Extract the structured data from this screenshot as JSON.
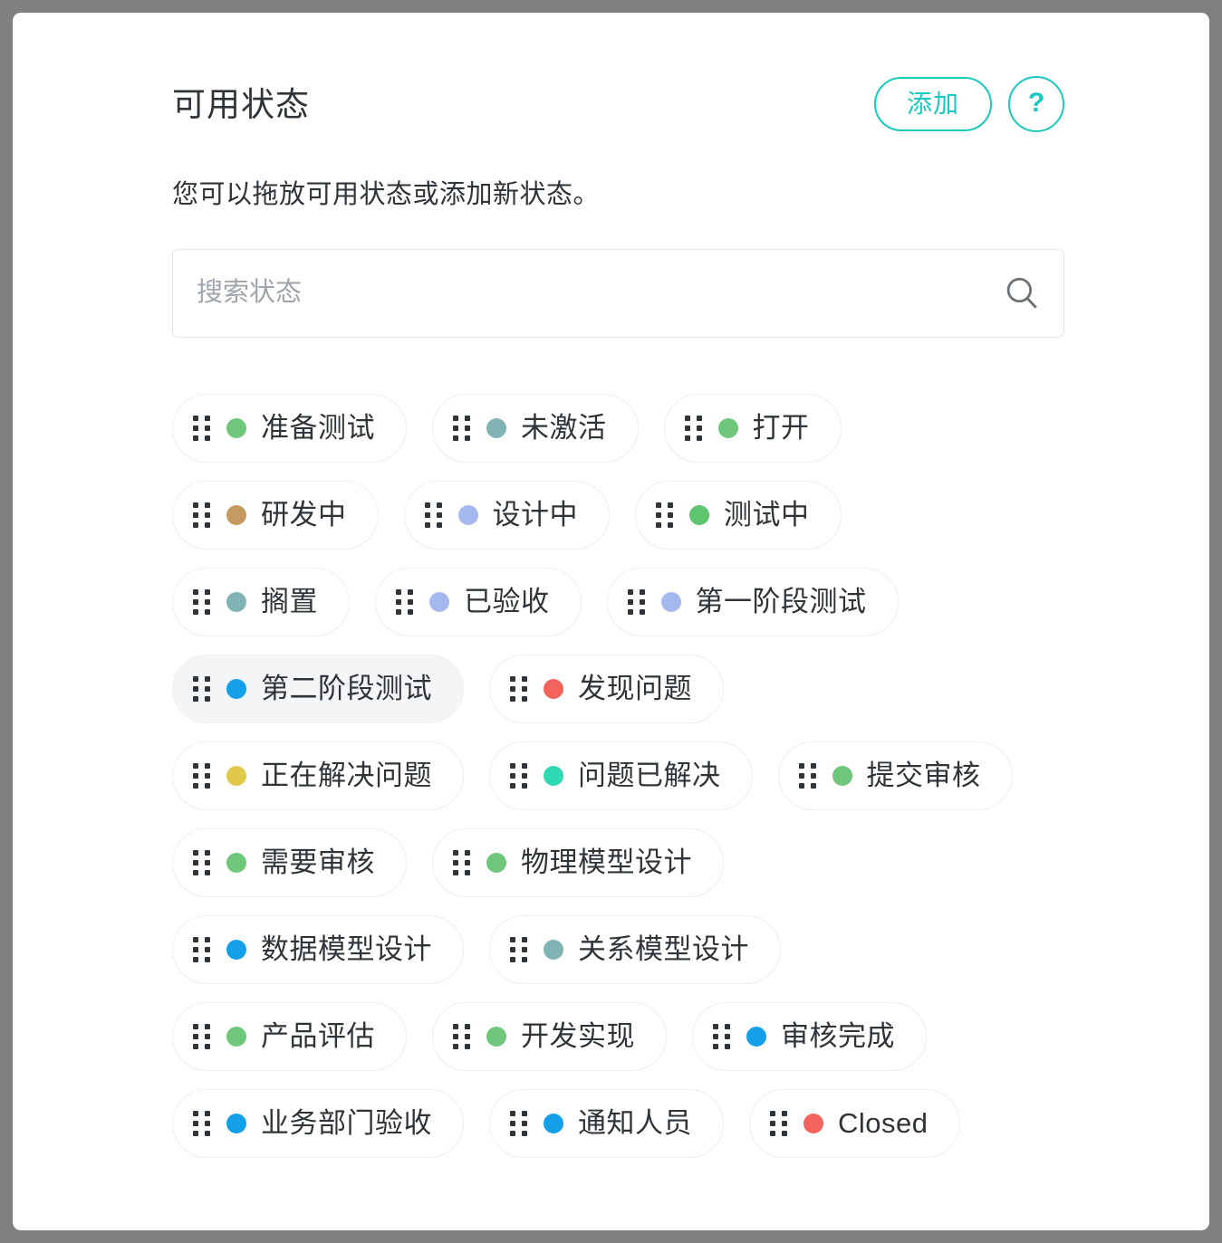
{
  "header": {
    "title": "可用状态",
    "add_label": "添加",
    "help_label": "?",
    "accent_color": "#19c9bf"
  },
  "subtitle": "您可以拖放可用状态或添加新状态。",
  "search": {
    "placeholder": "搜索状态",
    "value": "",
    "icon": "search-icon"
  },
  "status_rows": [
    [
      {
        "label": "准备测试",
        "color": "#6ec77a",
        "highlight": false,
        "handle": "drag-handle-icon"
      },
      {
        "label": "未激活",
        "color": "#80b4b4",
        "highlight": false,
        "handle": "drag-handle-icon"
      },
      {
        "label": "打开",
        "color": "#6ec77a",
        "highlight": false,
        "handle": "drag-handle-icon"
      }
    ],
    [
      {
        "label": "研发中",
        "color": "#c49a60",
        "highlight": false,
        "handle": "drag-handle-icon"
      },
      {
        "label": "设计中",
        "color": "#a5b8ec",
        "highlight": false,
        "handle": "drag-handle-icon"
      },
      {
        "label": "测试中",
        "color": "#5ec46e",
        "highlight": false,
        "handle": "drag-handle-icon"
      }
    ],
    [
      {
        "label": "搁置",
        "color": "#80b4b4",
        "highlight": false,
        "handle": "drag-handle-icon"
      },
      {
        "label": "已验收",
        "color": "#a5b8ec",
        "highlight": false,
        "handle": "drag-handle-icon"
      },
      {
        "label": "第一阶段测试",
        "color": "#a5b8ec",
        "highlight": false,
        "handle": "drag-handle-icon"
      }
    ],
    [
      {
        "label": "第二阶段测试",
        "color": "#13a0e8",
        "highlight": true,
        "handle": "drag-handle-icon"
      },
      {
        "label": "发现问题",
        "color": "#f4635c",
        "highlight": false,
        "handle": "drag-handle-icon"
      }
    ],
    [
      {
        "label": "正在解决问题",
        "color": "#e0c84a",
        "highlight": false,
        "handle": "drag-handle-icon"
      },
      {
        "label": "问题已解决",
        "color": "#2fd9b4",
        "highlight": false,
        "handle": "drag-handle-icon"
      },
      {
        "label": "提交审核",
        "color": "#6ec77a",
        "highlight": false,
        "handle": "drag-handle-icon"
      }
    ],
    [
      {
        "label": "需要审核",
        "color": "#6ec77a",
        "highlight": false,
        "handle": "drag-handle-icon"
      },
      {
        "label": "物理模型设计",
        "color": "#6ec77a",
        "highlight": false,
        "handle": "drag-handle-icon"
      }
    ],
    [
      {
        "label": "数据模型设计",
        "color": "#13a0e8",
        "highlight": false,
        "handle": "drag-handle-icon"
      },
      {
        "label": "关系模型设计",
        "color": "#80b4b4",
        "highlight": false,
        "handle": "drag-handle-icon"
      }
    ],
    [
      {
        "label": "产品评估",
        "color": "#6ec77a",
        "highlight": false,
        "handle": "drag-handle-icon"
      },
      {
        "label": "开发实现",
        "color": "#6ec77a",
        "highlight": false,
        "handle": "drag-handle-icon"
      },
      {
        "label": "审核完成",
        "color": "#13a0e8",
        "highlight": false,
        "handle": "drag-handle-icon"
      }
    ],
    [
      {
        "label": "业务部门验收",
        "color": "#13a0e8",
        "highlight": false,
        "handle": "drag-handle-icon"
      },
      {
        "label": "通知人员",
        "color": "#13a0e8",
        "highlight": false,
        "handle": "drag-handle-icon"
      },
      {
        "label": "Closed",
        "color": "#f4635c",
        "highlight": false,
        "handle": "drag-handle-icon"
      }
    ]
  ]
}
